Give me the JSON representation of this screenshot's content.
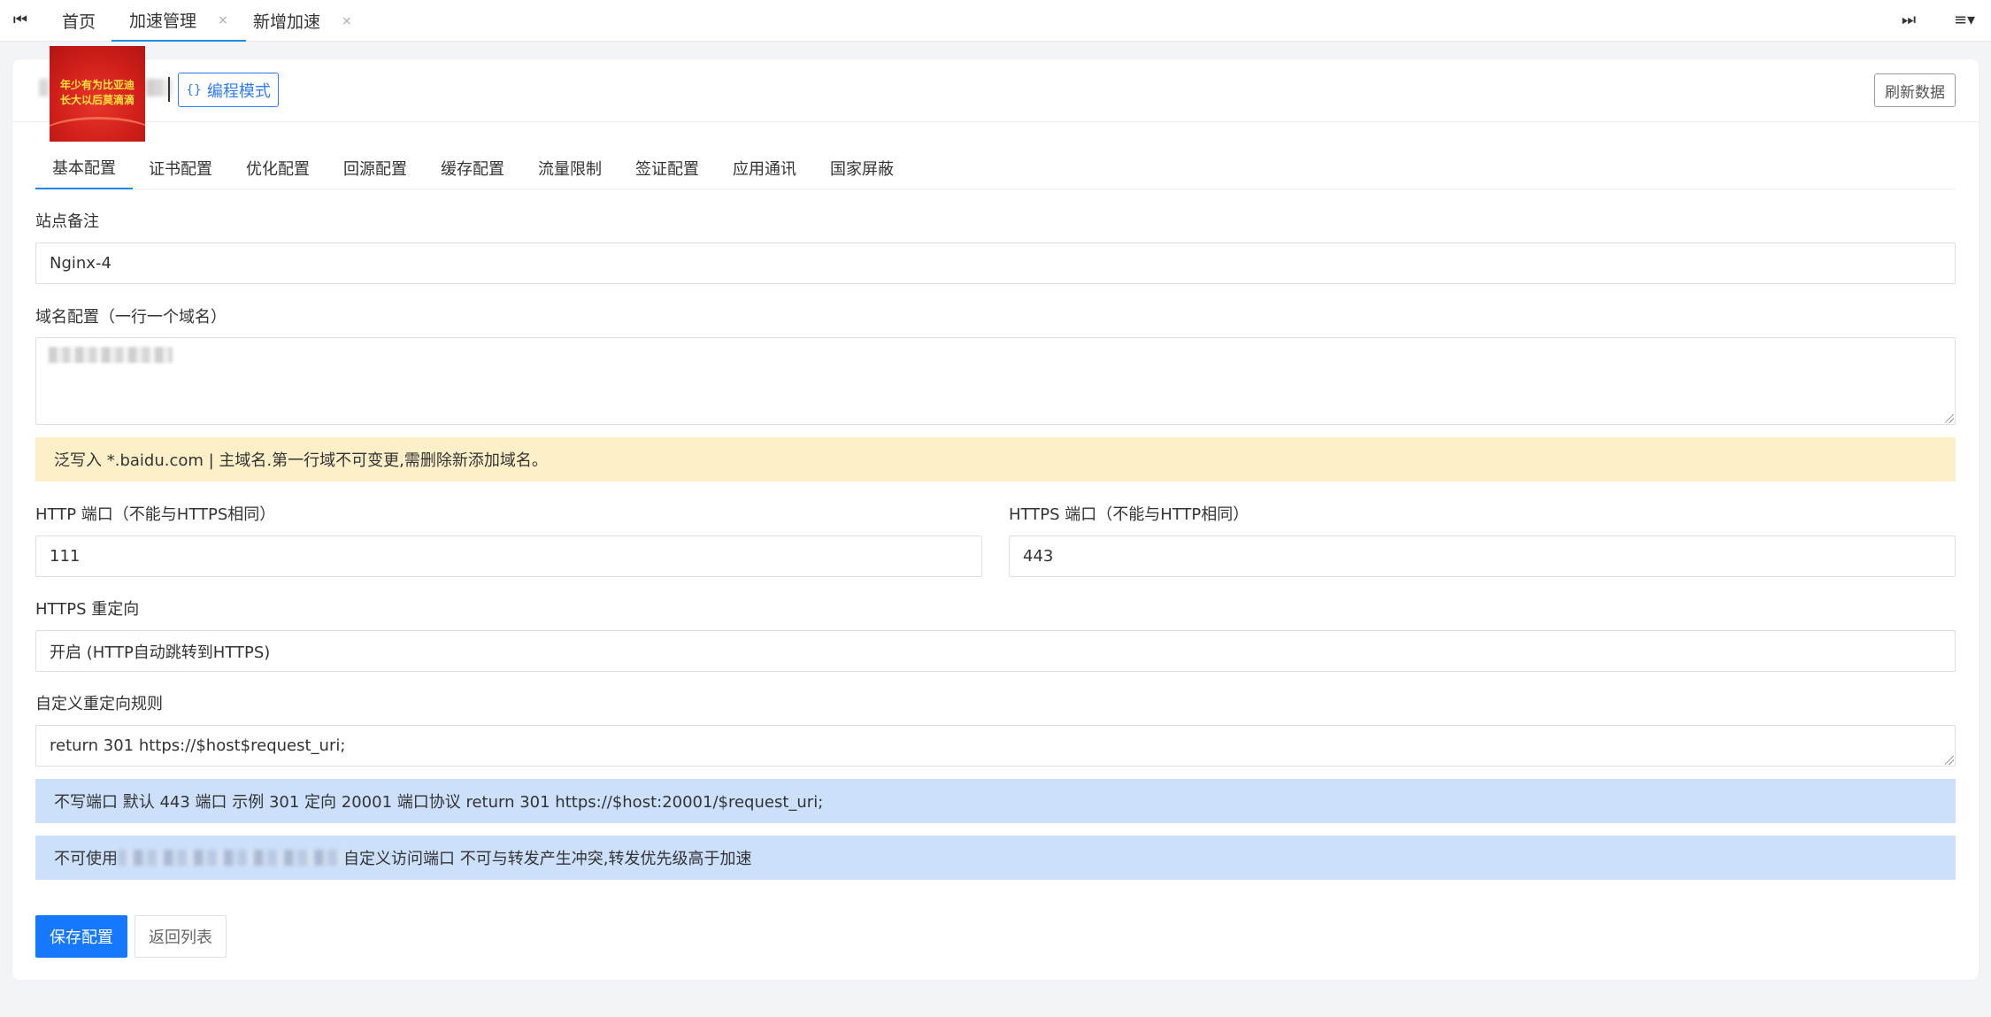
{
  "topbar": {
    "prev_icon": "skip-backward-icon",
    "next_icon": "skip-forward-icon",
    "menu_icon": "menu-dropdown-icon",
    "tabs": [
      {
        "label": "首页",
        "closable": false,
        "active": false
      },
      {
        "label": "加速管理",
        "closable": true,
        "active": true
      },
      {
        "label": "新增加速",
        "closable": true,
        "active": false
      }
    ],
    "close_glyph": "×"
  },
  "header": {
    "logo": {
      "line1": "年少有为比亚迪",
      "line2": "长大以后莫滴滴"
    },
    "code_mode_label": "编程模式",
    "code_mode_icon": "{}",
    "refresh_label": "刷新数据"
  },
  "subtabs": [
    {
      "label": "基本配置",
      "active": true
    },
    {
      "label": "证书配置"
    },
    {
      "label": "优化配置"
    },
    {
      "label": "回源配置"
    },
    {
      "label": "缓存配置"
    },
    {
      "label": "流量限制"
    },
    {
      "label": "签证配置"
    },
    {
      "label": "应用通讯"
    },
    {
      "label": "国家屏蔽"
    }
  ],
  "form": {
    "site_note": {
      "label": "站点备注",
      "value": "Nginx-4"
    },
    "domains": {
      "label": "域名配置（一行一个域名）"
    },
    "domain_tip": "泛写入 *.baidu.com | 主域名.第一行域不可变更,需删除新添加域名。",
    "http_port": {
      "label": "HTTP 端口（不能与HTTPS相同）",
      "value": "111"
    },
    "https_port": {
      "label": "HTTPS 端口（不能与HTTP相同）",
      "value": "443"
    },
    "https_redirect": {
      "label": "HTTPS 重定向",
      "value": "开启 (HTTP自动跳转到HTTPS)"
    },
    "custom_redirect": {
      "label": "自定义重定向规则",
      "value": "return 301 https://$host$request_uri;"
    },
    "redirect_tip": "不写端口 默认 443 端口 示例 301 定向 20001 端口协议 return 301 https://$host:20001/$request_uri;",
    "port_tip_prefix": "不可使用",
    "port_tip_suffix": "自定义访问端口 不可与转发产生冲突,转发优先级高于加速"
  },
  "actions": {
    "save_label": "保存配置",
    "back_label": "返回列表"
  },
  "colors": {
    "primary": "#1677ff",
    "warn_bg": "#fdefc7",
    "info_bg": "#cce0fb"
  }
}
